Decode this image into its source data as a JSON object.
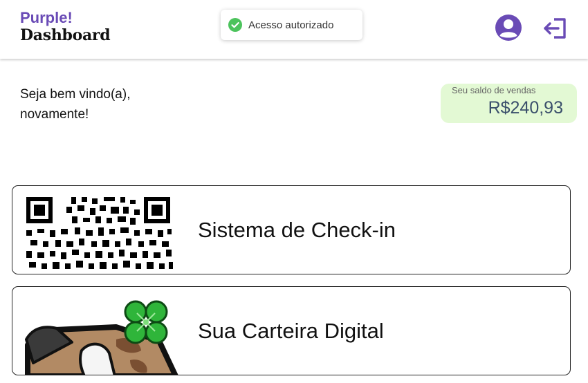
{
  "header": {
    "brand_top": "Purple!",
    "brand_bottom": "Dashboard",
    "toast_text": "Acesso autorizado",
    "icons": {
      "toast": "check-circle-icon",
      "avatar": "user-avatar-icon",
      "logout": "logout-icon"
    },
    "colors": {
      "brand": "#6a4bb6",
      "success": "#4cc35c"
    }
  },
  "welcome": {
    "line1": "Seja bem vindo(a),",
    "line2": "novamente!"
  },
  "balance": {
    "label": "Seu saldo de vendas",
    "value": "R$240,93",
    "background": "#e3f9d4"
  },
  "cards": [
    {
      "title": "Sistema de Check-in",
      "icon": "qr-code-icon"
    },
    {
      "title": "Sua Carteira Digital",
      "icon": "lucky-wallet-icon"
    }
  ]
}
